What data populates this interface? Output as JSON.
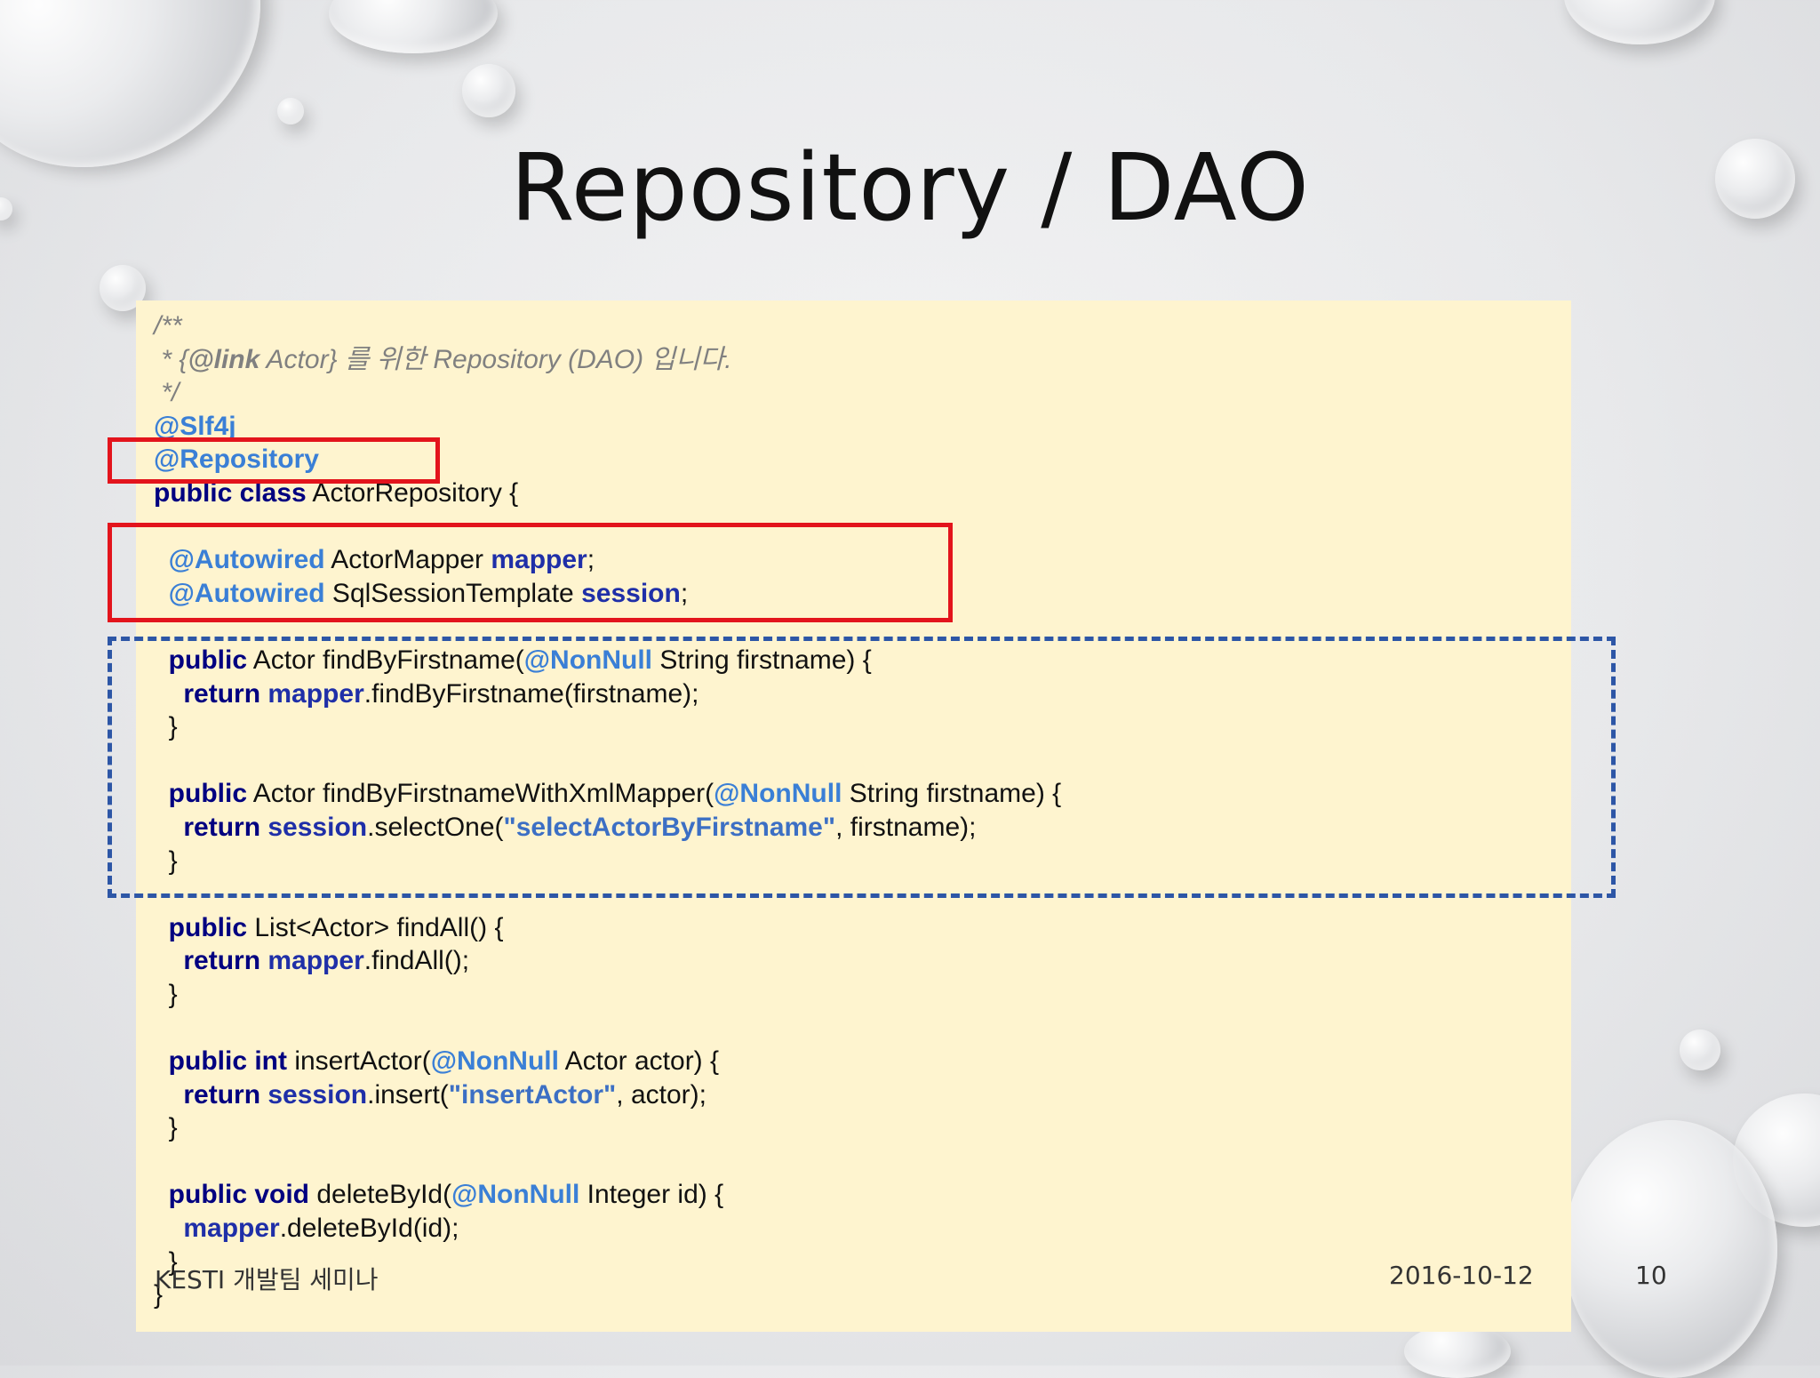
{
  "slide": {
    "title": "Repository / DAO",
    "footer_left": "KESTI 개발팀 세미나",
    "footer_date": "2016-10-12",
    "page_number": "10"
  },
  "code": {
    "c1": "/**",
    "c2a": " * {",
    "c2b": "@link",
    "c2c": " Actor} 를 위한 Repository (DAO) 입니다.",
    "c3": " */",
    "slf4j": "@Slf4j",
    "repository": "@Repository",
    "public_class": "public class",
    "class_name": " ActorRepository {",
    "autowired": "@Autowired",
    "mapper_type": " ActorMapper ",
    "mapper": "mapper",
    "session_type": " SqlSessionTemplate ",
    "session": "session",
    "semi": ";",
    "public": "public",
    "actor_m1": " Actor findByFirstname(",
    "nonnull": "@NonNull",
    "string_firstname": " String firstname) {",
    "ret": "return",
    "m1_body": ".findByFirstname(firstname);",
    "close": "}",
    "actor_m2": " Actor findByFirstnameWithXmlMapper(",
    "m2_body_a": ".selectOne(",
    "m2_str": "\"selectActorByFirstname\"",
    "m2_body_b": ", firstname);",
    "list_m3": " List<Actor> findAll() {",
    "m3_body": ".findAll();",
    "public_int": "public int",
    "m4_sig": " insertActor(",
    "m4_param": " Actor actor) {",
    "m4_body_a": ".insert(",
    "m4_str": "\"insertActor\"",
    "m4_body_b": ", actor);",
    "public_void": "public void",
    "m5_sig": " deleteById(",
    "m5_param": " Integer id) {",
    "m5_body": ".deleteById(id);"
  }
}
